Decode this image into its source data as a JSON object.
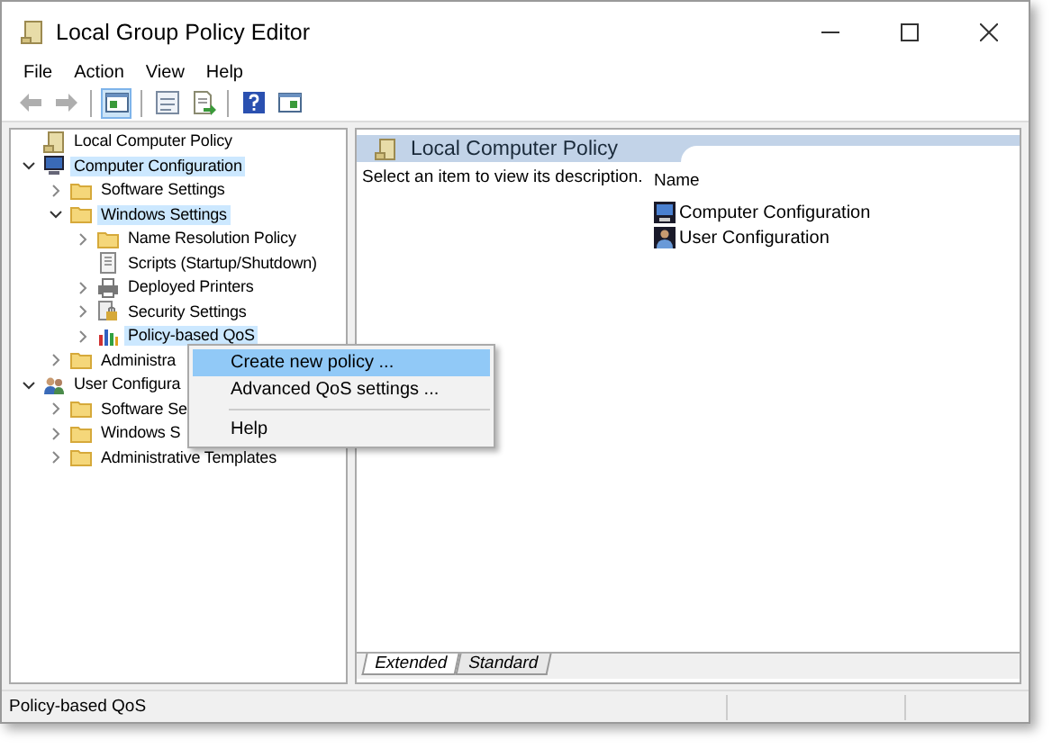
{
  "window": {
    "title": "Local Group Policy Editor"
  },
  "menu": [
    "File",
    "Action",
    "View",
    "Help"
  ],
  "toolbar": [
    {
      "kind": "back",
      "disabled": true,
      "pressed": false
    },
    {
      "kind": "forward",
      "disabled": true,
      "pressed": false
    },
    {
      "kind": "tree",
      "disabled": false,
      "pressed": true
    },
    {
      "kind": "properties",
      "disabled": false,
      "pressed": false
    },
    {
      "kind": "export",
      "disabled": false,
      "pressed": false
    },
    {
      "kind": "help",
      "disabled": false,
      "pressed": false
    },
    {
      "kind": "pane",
      "disabled": false,
      "pressed": false
    }
  ],
  "tree": [
    {
      "label": "Local Computer Policy",
      "kind": "policy",
      "selected": false
    },
    {
      "label": "Computer Configuration",
      "kind": "computer",
      "selected": true,
      "expanded": true,
      "children": [
        {
          "label": "Software Settings",
          "kind": "folder",
          "selected": false,
          "expanded": false
        },
        {
          "label": "Windows Settings",
          "kind": "folder",
          "selected": true,
          "expanded": true,
          "children": [
            {
              "label": "Name Resolution Policy",
              "kind": "folder",
              "selected": false,
              "expanded": false
            },
            {
              "label": "Scripts (Startup/Shutdown)",
              "kind": "script",
              "selected": false
            },
            {
              "label": "Deployed Printers",
              "kind": "printer",
              "selected": false,
              "expanded": false
            },
            {
              "label": "Security Settings",
              "kind": "security",
              "selected": false,
              "expanded": false
            },
            {
              "label": "Policy-based QoS",
              "kind": "chart",
              "selected": true,
              "expanded": false
            }
          ]
        },
        {
          "label": "Administra",
          "kind": "folder",
          "selected": false,
          "expanded": false
        }
      ]
    },
    {
      "label": "User Configura",
      "kind": "user",
      "selected": false,
      "expanded": true,
      "children": [
        {
          "label": "Software Se",
          "kind": "folder",
          "selected": false,
          "expanded": false
        },
        {
          "label": "Windows S",
          "kind": "folder",
          "selected": false,
          "expanded": false
        },
        {
          "label": "Administrative Templates",
          "kind": "folder",
          "selected": false,
          "expanded": false
        }
      ]
    }
  ],
  "content": {
    "header": "Local Computer Policy",
    "description": "Select an item to view its description.",
    "column": "Name",
    "items": [
      {
        "label": "Computer Configuration",
        "kind": "computer"
      },
      {
        "label": "User Configuration",
        "kind": "user"
      }
    ]
  },
  "view_tabs": [
    {
      "label": "Extended",
      "selected": true
    },
    {
      "label": "Standard",
      "selected": false
    }
  ],
  "context_menu": [
    {
      "label": "Create new policy ...",
      "selected": true,
      "separator_before": false
    },
    {
      "label": "Advanced QoS settings ...",
      "selected": false,
      "separator_before": false
    },
    {
      "label": "Help",
      "selected": false,
      "separator_before": true
    }
  ],
  "status_bar": "Policy-based QoS"
}
